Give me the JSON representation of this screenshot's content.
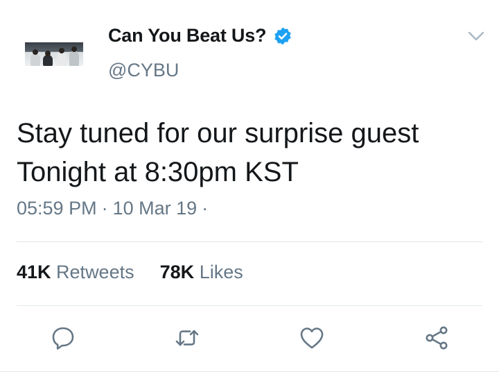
{
  "tweet": {
    "display_name": "Can You Beat Us?",
    "handle": "@CYBU",
    "verified": true,
    "text_lines": [
      "Stay tuned for our surprise guest",
      "Tonight at 8:30pm KST"
    ],
    "time": "05:59 PM",
    "separator": "·",
    "date": "10 Mar 19",
    "trailing_separator": "·"
  },
  "stats": {
    "retweets_count": "41K",
    "retweets_label": "Retweets",
    "likes_count": "78K",
    "likes_label": "Likes"
  },
  "icons": {
    "verified": "verified-badge-icon",
    "caret": "chevron-down-icon",
    "reply": "reply-icon",
    "retweet": "retweet-icon",
    "like": "heart-icon",
    "share": "share-icon"
  },
  "colors": {
    "text": "#14171a",
    "secondary": "#657786",
    "verified": "#1da1f2",
    "divider": "#e1e8ed",
    "icon": "#657786"
  }
}
